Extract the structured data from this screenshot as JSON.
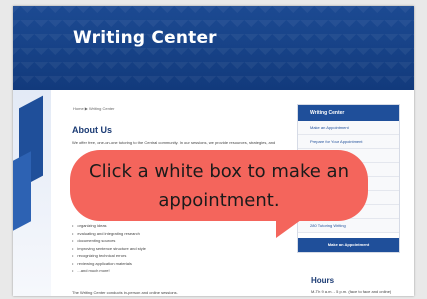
{
  "header": {
    "title": "Writing Center"
  },
  "breadcrumb": "Home ▶ Writing Center",
  "about": {
    "title": "About Us",
    "paragraph": "We offer free, one-on-one tutoring to the Central community. In our sessions, we provide resources, strategies, and",
    "list": [
      "organizing ideas",
      "evaluating and integrating research",
      "documenting sources",
      "improving sentence structure and style",
      "recognizing technical errors",
      "reviewing application materials",
      "...and much more!"
    ],
    "bottom_text": "The Writing Center conducts in-person and online sessions."
  },
  "sidebar": {
    "heading": "Writing Center",
    "items": [
      "Make an Appointment",
      "Prepare for Your Appointment",
      "",
      "Justice, and Writing",
      "",
      "",
      "Employment",
      "280 Tutoring Writing"
    ],
    "button": "Make an Appointment"
  },
  "hours": {
    "title": "Hours",
    "text": "M-Th 9 a.m. - 5 p.m. (face to face and online)"
  },
  "callout": {
    "text": "Click a white box to make an appointment."
  }
}
